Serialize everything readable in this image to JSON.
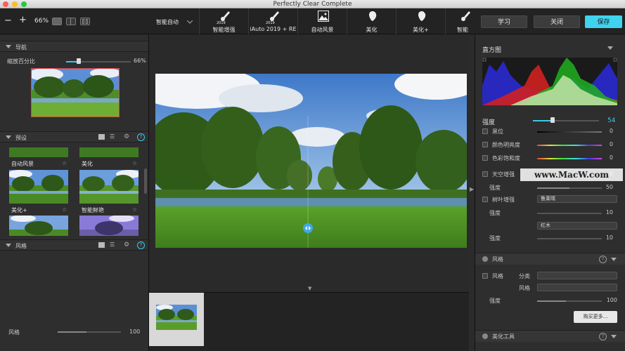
{
  "window": {
    "title": "Perfectly Clear Complete"
  },
  "toolbar": {
    "zoom_out": "−",
    "zoom_in": "+",
    "zoom_level": "66%",
    "preset_name": "智能自动",
    "tools": [
      {
        "label": "智能增强",
        "icon": "brush-2019-icon",
        "badge": "2019"
      },
      {
        "label": "iAuto 2019 + RE",
        "icon": "brush-2019-icon",
        "badge": "2019"
      },
      {
        "label": "自动风景",
        "icon": "landscape-icon"
      },
      {
        "label": "美化",
        "icon": "face-icon"
      },
      {
        "label": "美化+",
        "icon": "face-plus-icon"
      },
      {
        "label": "智能",
        "icon": "brush-icon"
      }
    ],
    "learn_label": "学习",
    "close_label": "关闭",
    "save_label": "保存"
  },
  "left": {
    "nav": {
      "title": "导航",
      "zoom_label": "缩放百分比",
      "zoom_value": "66%",
      "zoom_fraction": 0.2
    },
    "presets": {
      "title": "预设",
      "items": [
        {
          "label": "自动风景"
        },
        {
          "label": "美化"
        },
        {
          "label": "美化+"
        },
        {
          "label": "智能鲜艳"
        }
      ]
    },
    "style": {
      "title": "风格",
      "slider_label": "风格",
      "slider_value": "100",
      "slider_fraction": 0.45
    }
  },
  "right": {
    "histogram": {
      "title": "直方图"
    },
    "strength": {
      "label": "强度",
      "value": "54",
      "fraction": 0.3
    },
    "rows": [
      {
        "label": "黑位",
        "value": "0"
      },
      {
        "label": "颜色明亮度",
        "value": "0"
      },
      {
        "label": "色彩饱和度",
        "value": "0"
      },
      {
        "label": "天空增强",
        "value": "0"
      }
    ],
    "sky_strength": {
      "label": "强度",
      "value": "50",
      "fraction": 0.5
    },
    "foliage": {
      "label": "树叶增强",
      "dropdown": "鲁莱晴",
      "strength_label": "强度",
      "strength_value": "10",
      "color_dropdown": "红木",
      "strength2_label": "强度",
      "strength2_value": "10"
    },
    "style_section": {
      "title": "风格",
      "row_label": "风格",
      "category_label": "分类",
      "style_label": "风格",
      "strength_label": "强度",
      "strength_value": "100",
      "strength_fraction": 0.45,
      "buy_more": "购买更多..."
    },
    "beauty_tools": {
      "title": "美化工具"
    }
  },
  "watermark": "www.MacW.com"
}
